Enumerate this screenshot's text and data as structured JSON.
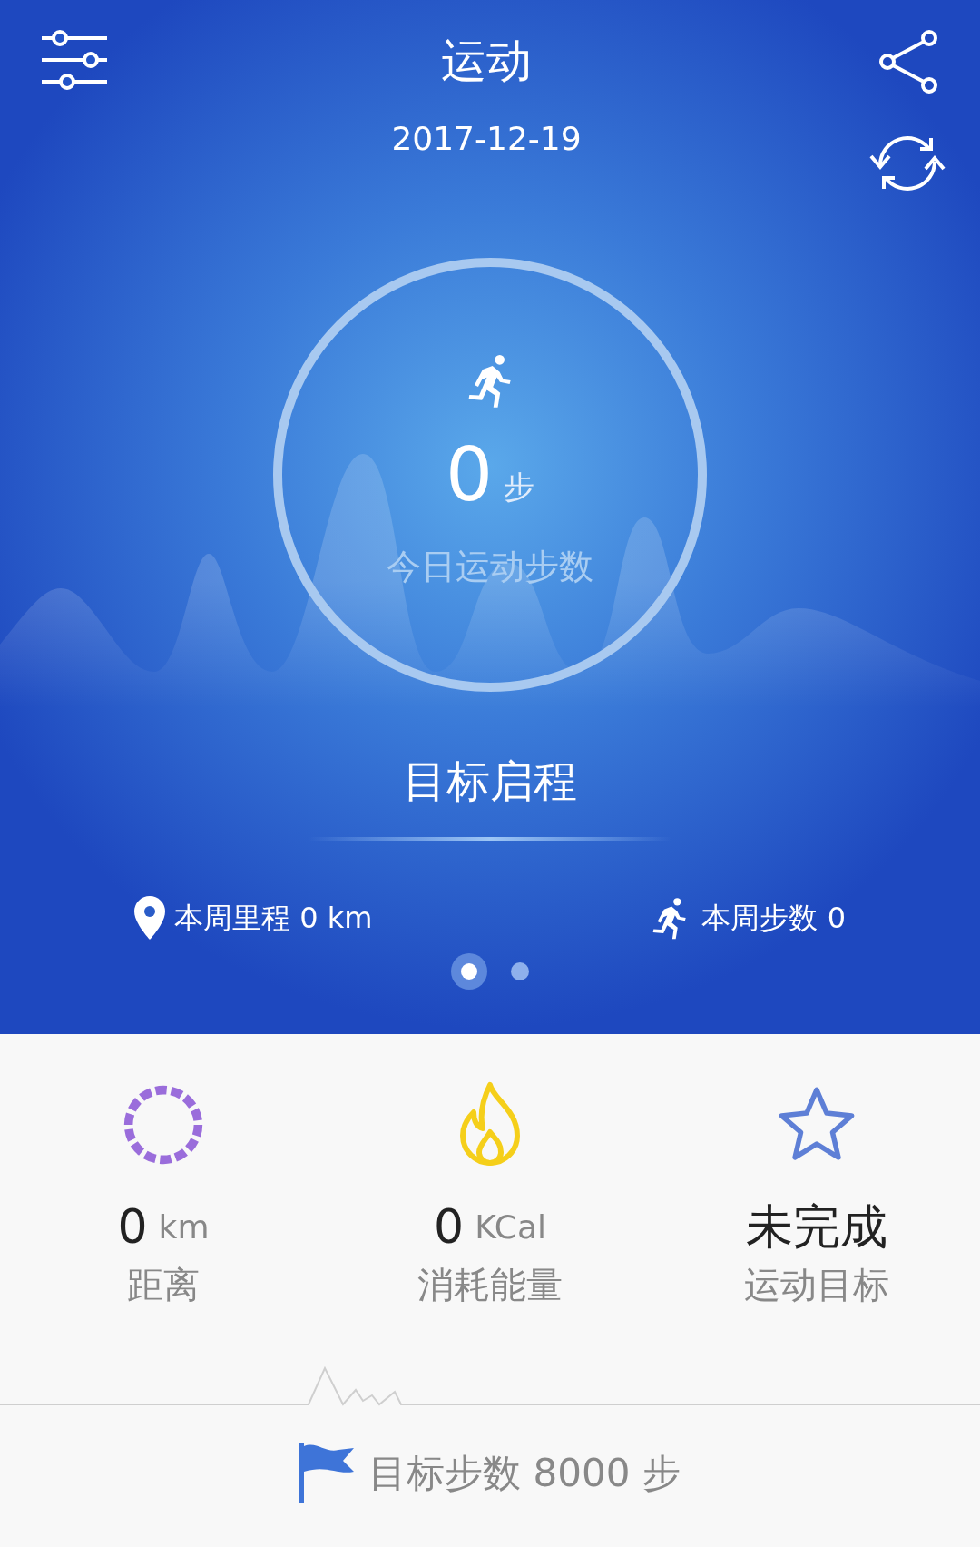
{
  "header": {
    "title": "运动",
    "date": "2017-12-19"
  },
  "ring": {
    "steps": "0",
    "unit": "步",
    "caption": "今日运动步数"
  },
  "goal_banner": "目标启程",
  "weekly": [
    {
      "kind": "distance",
      "text": "本周里程 0 km"
    },
    {
      "kind": "steps",
      "text": "本周步数 0"
    }
  ],
  "pager": [
    {
      "selected": true
    },
    {
      "selected": false
    }
  ],
  "stats": [
    {
      "kind": "distance",
      "value": "0",
      "unit": "km",
      "label": "距离"
    },
    {
      "kind": "calories",
      "value": "0",
      "unit": "KCal",
      "label": "消耗能量"
    },
    {
      "kind": "goal",
      "value": "未完成",
      "label": "运动目标"
    }
  ],
  "target": "目标步数 8000 步"
}
